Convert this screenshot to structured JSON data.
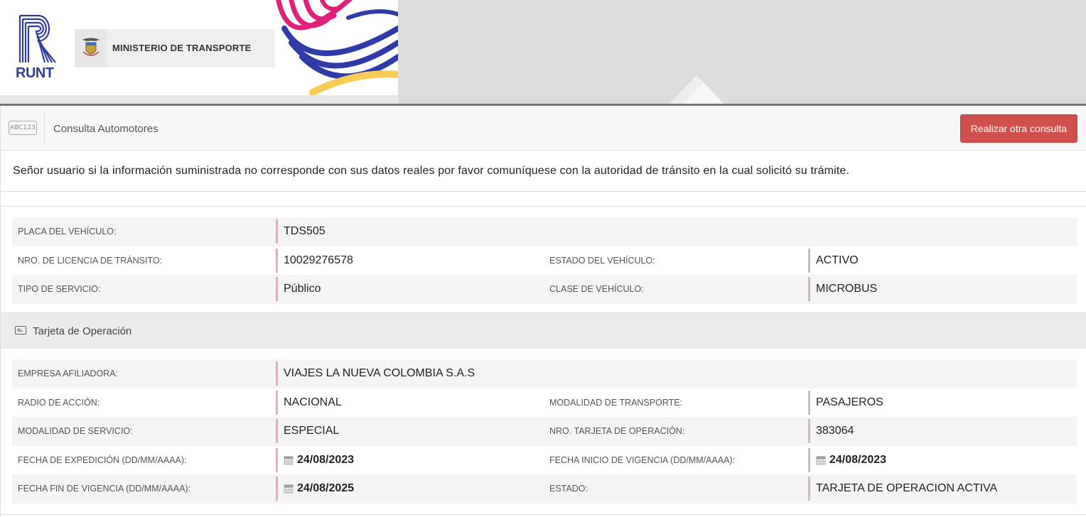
{
  "header": {
    "runt_label": "RUNT",
    "ministry_label": "MINISTERIO DE TRANSPORTE",
    "colors": {
      "runt_blue": "#2f3d9c",
      "wave_pink": "#e2207a",
      "wave_blue": "#2f3ba8",
      "wave_yellow": "#f7cc55"
    }
  },
  "consulta": {
    "icon": "abc123-icon",
    "icon_text": "ABC123",
    "title": "Consulta Automotores",
    "button_label": "Realizar otra consulta",
    "button_color": "#d0504d"
  },
  "notice": "Señor usuario si la información suministrada no corresponde con sus datos reales por favor comuníquese con la autoridad de tránsito en la cual solicitó su trámite.",
  "vehiculo": {
    "placa_label": "PLACA DEL VEHÍCULO:",
    "placa": "TDS505",
    "licencia_label": "NRO. DE LICENCIA DE TRÁNSITO:",
    "licencia": "10029276578",
    "estado_label": "ESTADO DEL VEHÍCULO:",
    "estado": "ACTIVO",
    "servicio_label": "TIPO DE SERVICIO:",
    "servicio": "Público",
    "clase_label": "CLASE DE VEHÍCULO:",
    "clase": "MICROBUS"
  },
  "tarjeta": {
    "section_title": "Tarjeta de Operación",
    "section_icon": "id-card-icon",
    "empresa_label": "EMPRESA AFILIADORA:",
    "empresa": "VIAJES LA NUEVA COLOMBIA S.A.S",
    "radio_label": "RADIO DE ACCIÓN:",
    "radio": "NACIONAL",
    "modalidad_transporte_label": "MODALIDAD DE TRANSPORTE:",
    "modalidad_transporte": "PASAJEROS",
    "modalidad_servicio_label": "MODALIDAD DE SERVICIO:",
    "modalidad_servicio": "ESPECIAL",
    "nro_tarjeta_label": "NRO. TARJETA DE OPERACIÓN:",
    "nro_tarjeta": "383064",
    "fecha_expedicion_label": "FECHA DE EXPEDICIÓN (DD/MM/AAAA):",
    "fecha_expedicion": "24/08/2023",
    "fecha_inicio_label": "FECHA INICIO DE VIGENCIA (DD/MM/AAAA):",
    "fecha_inicio": "24/08/2023",
    "fecha_fin_label": "FECHA FIN DE VIGENCIA (DD/MM/AAAA):",
    "fecha_fin": "24/08/2025",
    "estado_label": "ESTADO:",
    "estado": "TARJETA DE OPERACION ACTIVA"
  }
}
